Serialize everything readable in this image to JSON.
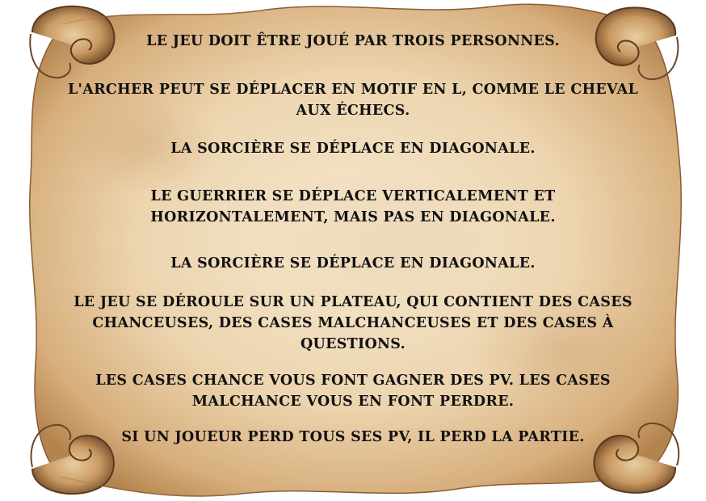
{
  "colors": {
    "parchment": "#f1dcba",
    "parchment_dark": "#b98a57",
    "edge_brown": "#6b4427",
    "text": "#111111"
  },
  "rules": [
    {
      "lines": [
        "LE JEU DOIT ÊTRE JOUÉ PAR TROIS PERSONNES."
      ]
    },
    {
      "lines": [
        "L'ARCHER PEUT SE DÉPLACER EN MOTIF EN L, COMME LE CHEVAL",
        "AUX ÉCHECS."
      ]
    },
    {
      "lines": [
        "LA SORCIÈRE SE DÉPLACE EN DIAGONALE."
      ]
    },
    {
      "lines": [
        "LE GUERRIER SE DÉPLACE VERTICALEMENT ET",
        "HORIZONTALEMENT, MAIS PAS EN DIAGONALE."
      ]
    },
    {
      "lines": [
        "LA SORCIÈRE SE DÉPLACE EN DIAGONALE."
      ]
    },
    {
      "lines": [
        "LE JEU SE DÉROULE SUR UN PLATEAU, QUI CONTIENT DES CASES",
        "CHANCEUSES, DES CASES  MALCHANCEUSES ET DES CASES À",
        "QUESTIONS."
      ]
    },
    {
      "lines": [
        "LES CASES CHANCE VOUS FONT GAGNER DES PV. LES CASES",
        "MALCHANCE VOUS EN FONT PERDRE."
      ]
    },
    {
      "lines": [
        "SI UN JOUEUR PERD TOUS SES PV, IL PERD LA PARTIE."
      ]
    }
  ]
}
